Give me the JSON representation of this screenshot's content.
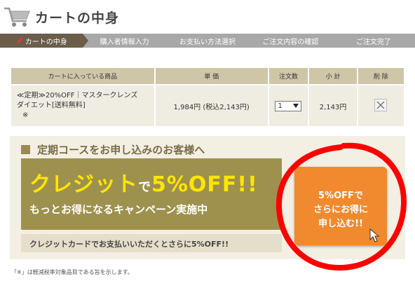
{
  "header": {
    "title": "カートの中身",
    "cart_icon": "cart-icon"
  },
  "steps": [
    "カートの中身",
    "購入者情報入力",
    "お支払い方法選択",
    "ご注文内容の確認",
    "ご注文完了"
  ],
  "table": {
    "headers": {
      "product": "カートに入っている商品",
      "price": "単 価",
      "qty": "注文数",
      "subtotal": "小 計",
      "delete": "削 除"
    },
    "row": {
      "name_line1": "≪定期≫20%OFF｜マスタークレンズ",
      "name_line2": "ダイエット[送料無料]",
      "name_line3": "※",
      "price": "1,984円 (税込2,143円)",
      "qty": "1",
      "subtotal": "2,143円"
    }
  },
  "promo": {
    "heading": "定期コースをお申し込みのお客様へ",
    "banner_big1": "クレジット",
    "banner_small": "で",
    "banner_big2": "5%OFF!!",
    "banner_line2": "もっとお得になるキャンペーン実施中",
    "footer": "クレジットカードでお支払いいただくとさらに5%OFF!!",
    "cta_line1": "5%OFFで",
    "cta_line2": "さらにお得に",
    "cta_line3": "申し込む!!"
  },
  "footnote": "「※」は軽減税率対象品目である旨を示します。",
  "colors": {
    "step_active": "#6b5d4a",
    "step_inactive": "#a8a8a8",
    "cta": "#f18a2e",
    "highlight": "#ff0000",
    "banner": "#9e914e",
    "banner_text": "#ffe600"
  }
}
